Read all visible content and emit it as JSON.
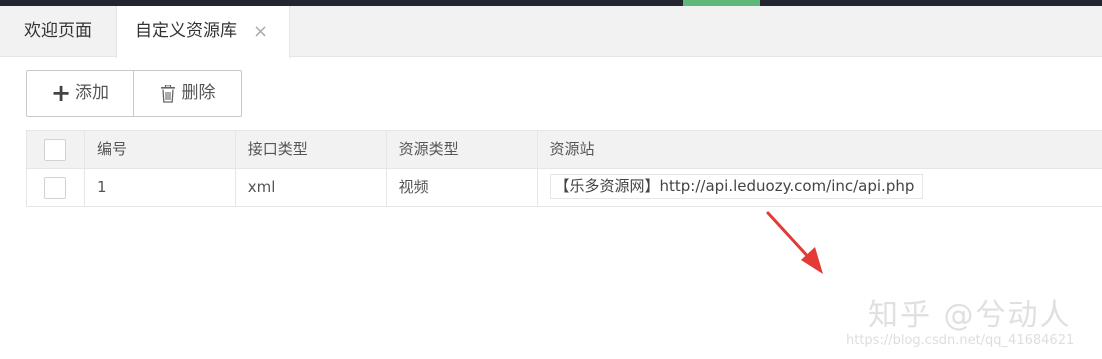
{
  "tabs": {
    "home_label": "欢迎页面",
    "active_label": "自定义资源库",
    "close_glyph": "×"
  },
  "toolbar": {
    "add_label": "添加",
    "delete_label": "删除"
  },
  "table": {
    "headers": [
      "编号",
      "接口类型",
      "资源类型",
      "资源站"
    ],
    "rows": [
      {
        "id": "1",
        "api_type": "xml",
        "resource_type": "视频",
        "site": "【乐多资源网】http://api.leduozy.com/inc/api.php"
      }
    ]
  },
  "watermark": {
    "text": "知乎 @兮动人",
    "url": "https://blog.csdn.net/qq_41684621"
  },
  "colors": {
    "topbar": "#23262e",
    "topbar_accent": "#5fb878",
    "arrow": "#e53935"
  }
}
